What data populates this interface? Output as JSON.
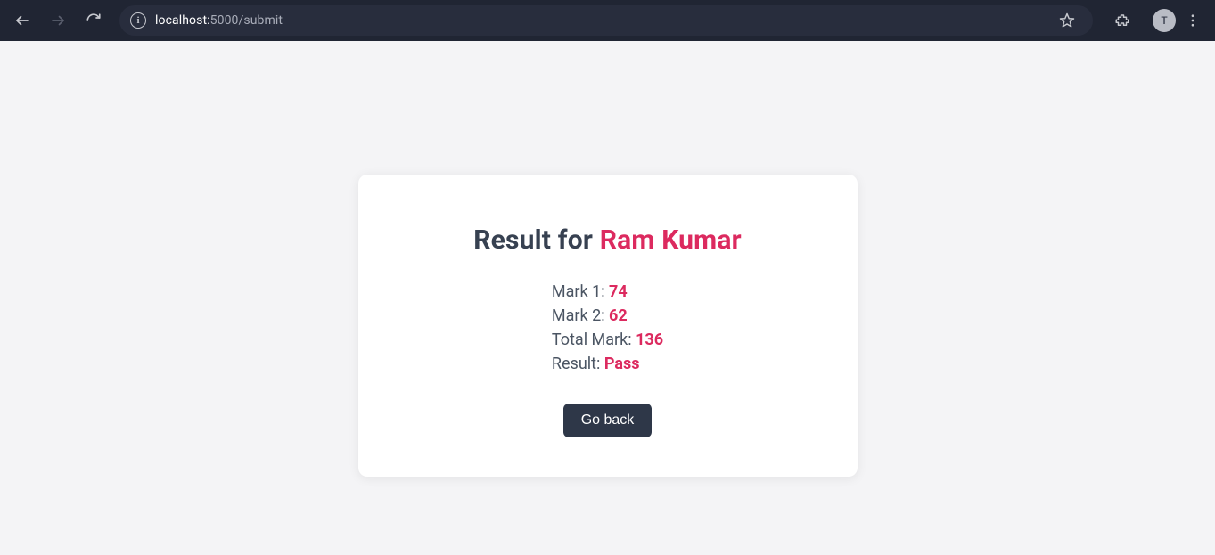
{
  "browser": {
    "url_host": "localhost:",
    "url_path": "5000/submit",
    "avatar_initial": "T"
  },
  "result": {
    "heading_prefix": "Result for ",
    "student_name": "Ram Kumar",
    "rows": {
      "mark1_label": "Mark 1: ",
      "mark1_value": "74",
      "mark2_label": "Mark 2: ",
      "mark2_value": "62",
      "total_label": "Total Mark: ",
      "total_value": "136",
      "result_label": "Result: ",
      "result_value": "Pass"
    },
    "go_back_label": "Go back"
  }
}
